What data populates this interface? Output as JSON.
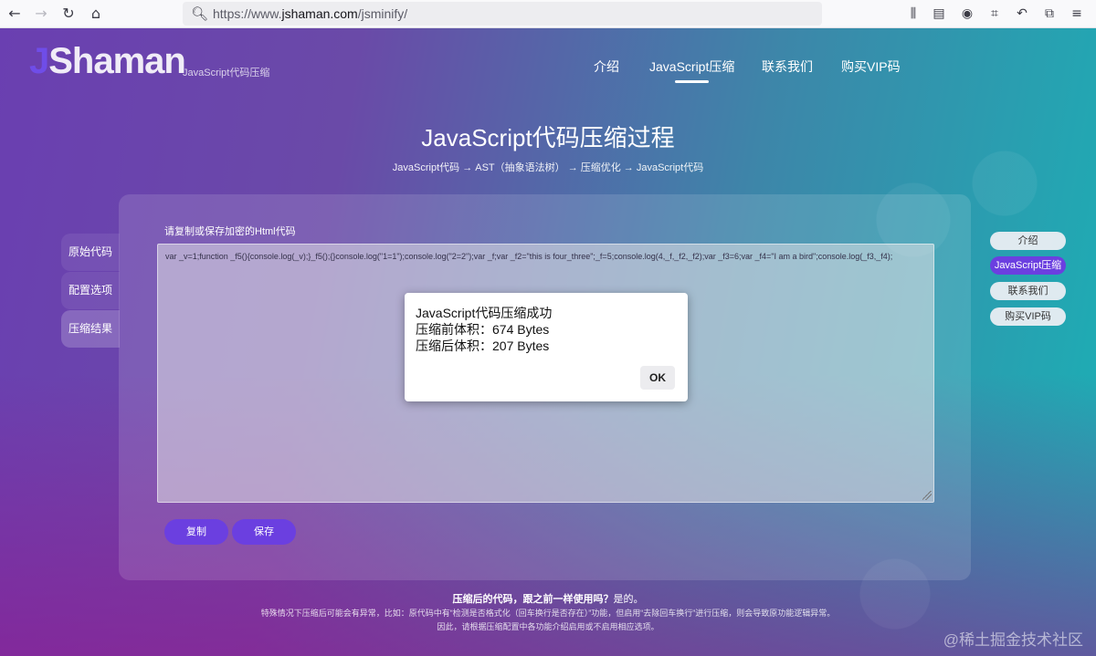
{
  "browser": {
    "url_prefix": "https://www.",
    "url_domain": "jshaman.com",
    "url_path": "/jsminify/"
  },
  "site": {
    "logo_j": "J",
    "logo_rest": "Shaman",
    "logo_sub": "JavaScript代码压缩",
    "nav": [
      "介绍",
      "JavaScript压缩",
      "联系我们",
      "购买VIP码"
    ]
  },
  "hero": {
    "title": "JavaScript代码压缩过程",
    "subtitle": "JavaScript代码 → AST（抽象语法树） → 压缩优化 → JavaScript代码"
  },
  "side_tabs": [
    "原始代码",
    "配置选项",
    "压缩结果"
  ],
  "panel": {
    "label": "请复制或保存加密的Html代码",
    "code": "var _v=1;function _f5(){console.log(_v);}_f5();{}console.log(\"1=1\");console.log(\"2=2\");var _f;var _f2=\"this is four_three\";_f=5;console.log(4,_f,_f2,_f2);var _f3=6;var _f4=\"I am a bird\";console.log(_f3,_f4);",
    "copy_label": "复制",
    "save_label": "保存"
  },
  "right_nav": [
    "介绍",
    "JavaScript压缩",
    "联系我们",
    "购买VIP码"
  ],
  "footer": {
    "question": "压缩后的代码，跟之前一样使用吗？",
    "answer": "是的。",
    "note1": "特殊情况下压缩后可能会有异常，比如：原代码中有“检测是否格式化（回车换行是否存在）”功能，但启用“去除回车换行”进行压缩，则会导致原功能逻辑异常。",
    "note2": "因此，请根据压缩配置中各功能介绍启用或不启用相应选项。"
  },
  "watermark": "@稀土掘金技术社区",
  "dialog": {
    "line1": "JavaScript代码压缩成功",
    "line2": "压缩前体积：674 Bytes",
    "line3": "压缩后体积：207 Bytes",
    "ok_label": "OK"
  }
}
